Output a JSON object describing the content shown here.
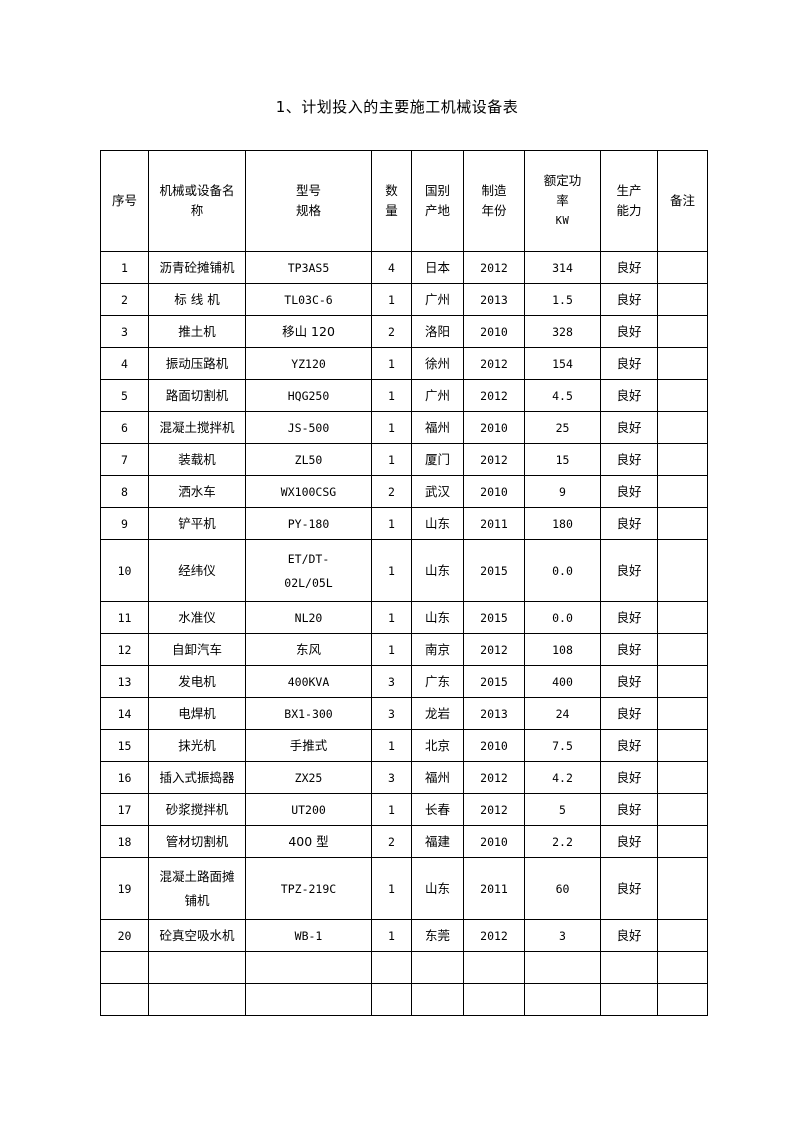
{
  "document": {
    "title": "1、计划投入的主要施工机械设备表"
  },
  "table": {
    "headers": {
      "index": "序号",
      "name_line1": "机械或设备名",
      "name_line2": "称",
      "model_line1": "型号",
      "model_line2": "规格",
      "qty_line1": "数",
      "qty_line2": "量",
      "origin_line1": "国别",
      "origin_line2": "产地",
      "year_line1": "制造",
      "year_line2": "年份",
      "power_line1": "额定功",
      "power_line2": "率",
      "power_line3": "KW",
      "capacity_line1": "生产",
      "capacity_line2": "能力",
      "note": "备注"
    },
    "rows": [
      {
        "index": "1",
        "name": "沥青砼摊铺机",
        "name2": "",
        "model": "TP3AS5",
        "model2": "",
        "qty": "4",
        "origin": "日本",
        "year": "2012",
        "power": "314",
        "capacity": "良好",
        "note": ""
      },
      {
        "index": "2",
        "name": "标 线 机",
        "name2": "",
        "model": "TL03C-6",
        "model2": "",
        "qty": "1",
        "origin": "广州",
        "year": "2013",
        "power": "1.5",
        "capacity": "良好",
        "note": ""
      },
      {
        "index": "3",
        "name": "推土机",
        "name2": "",
        "model": "移山 120",
        "model2": "",
        "qty": "2",
        "origin": "洛阳",
        "year": "2010",
        "power": "328",
        "capacity": "良好",
        "note": ""
      },
      {
        "index": "4",
        "name": "振动压路机",
        "name2": "",
        "model": "YZ120",
        "model2": "",
        "qty": "1",
        "origin": "徐州",
        "year": "2012",
        "power": "154",
        "capacity": "良好",
        "note": ""
      },
      {
        "index": "5",
        "name": "路面切割机",
        "name2": "",
        "model": "HQG250",
        "model2": "",
        "qty": "1",
        "origin": "广州",
        "year": "2012",
        "power": "4.5",
        "capacity": "良好",
        "note": ""
      },
      {
        "index": "6",
        "name": "混凝土搅拌机",
        "name2": "",
        "model": "JS-500",
        "model2": "",
        "qty": "1",
        "origin": "福州",
        "year": "2010",
        "power": "25",
        "capacity": "良好",
        "note": ""
      },
      {
        "index": "7",
        "name": "装载机",
        "name2": "",
        "model": "ZL50",
        "model2": "",
        "qty": "1",
        "origin": "厦门",
        "year": "2012",
        "power": "15",
        "capacity": "良好",
        "note": ""
      },
      {
        "index": "8",
        "name": "洒水车",
        "name2": "",
        "model": "WX100CSG",
        "model2": "",
        "qty": "2",
        "origin": "武汉",
        "year": "2010",
        "power": "9",
        "capacity": "良好",
        "note": ""
      },
      {
        "index": "9",
        "name": "铲平机",
        "name2": "",
        "model": "PY-180",
        "model2": "",
        "qty": "1",
        "origin": "山东",
        "year": "2011",
        "power": "180",
        "capacity": "良好",
        "note": ""
      },
      {
        "index": "10",
        "name": "经纬仪",
        "name2": "",
        "model": "ET/DT-",
        "model2": "02L/05L",
        "qty": "1",
        "origin": "山东",
        "year": "2015",
        "power": "0.0",
        "capacity": "良好",
        "note": "",
        "tall": true
      },
      {
        "index": "11",
        "name": "水准仪",
        "name2": "",
        "model": "NL20",
        "model2": "",
        "qty": "1",
        "origin": "山东",
        "year": "2015",
        "power": "0.0",
        "capacity": "良好",
        "note": ""
      },
      {
        "index": "12",
        "name": "自卸汽车",
        "name2": "",
        "model": "东风",
        "model2": "",
        "qty": "1",
        "origin": "南京",
        "year": "2012",
        "power": "108",
        "capacity": "良好",
        "note": ""
      },
      {
        "index": "13",
        "name": "发电机",
        "name2": "",
        "model": "400KVA",
        "model2": "",
        "qty": "3",
        "origin": "广东",
        "year": "2015",
        "power": "400",
        "capacity": "良好",
        "note": ""
      },
      {
        "index": "14",
        "name": "电焊机",
        "name2": "",
        "model": "BX1-300",
        "model2": "",
        "qty": "3",
        "origin": "龙岩",
        "year": "2013",
        "power": "24",
        "capacity": "良好",
        "note": ""
      },
      {
        "index": "15",
        "name": "抹光机",
        "name2": "",
        "model": "手推式",
        "model2": "",
        "qty": "1",
        "origin": "北京",
        "year": "2010",
        "power": "7.5",
        "capacity": "良好",
        "note": ""
      },
      {
        "index": "16",
        "name": "插入式振捣器",
        "name2": "",
        "model": "ZX25",
        "model2": "",
        "qty": "3",
        "origin": "福州",
        "year": "2012",
        "power": "4.2",
        "capacity": "良好",
        "note": ""
      },
      {
        "index": "17",
        "name": "砂浆搅拌机",
        "name2": "",
        "model": "UT200",
        "model2": "",
        "qty": "1",
        "origin": "长春",
        "year": "2012",
        "power": "5",
        "capacity": "良好",
        "note": ""
      },
      {
        "index": "18",
        "name": "管材切割机",
        "name2": "",
        "model": "400 型",
        "model2": "",
        "qty": "2",
        "origin": "福建",
        "year": "2010",
        "power": "2.2",
        "capacity": "良好",
        "note": ""
      },
      {
        "index": "19",
        "name": "混凝土路面摊",
        "name2": "铺机",
        "model": "TPZ-219C",
        "model2": "",
        "qty": "1",
        "origin": "山东",
        "year": "2011",
        "power": "60",
        "capacity": "良好",
        "note": "",
        "tall": true
      },
      {
        "index": "20",
        "name": "砼真空吸水机",
        "name2": "",
        "model": "WB-1",
        "model2": "",
        "qty": "1",
        "origin": "东莞",
        "year": "2012",
        "power": "3",
        "capacity": "良好",
        "note": ""
      },
      {
        "index": "",
        "name": "",
        "name2": "",
        "model": "",
        "model2": "",
        "qty": "",
        "origin": "",
        "year": "",
        "power": "",
        "capacity": "",
        "note": "",
        "blank": true
      },
      {
        "index": "",
        "name": "",
        "name2": "",
        "model": "",
        "model2": "",
        "qty": "",
        "origin": "",
        "year": "",
        "power": "",
        "capacity": "",
        "note": "",
        "blank": true
      }
    ]
  }
}
